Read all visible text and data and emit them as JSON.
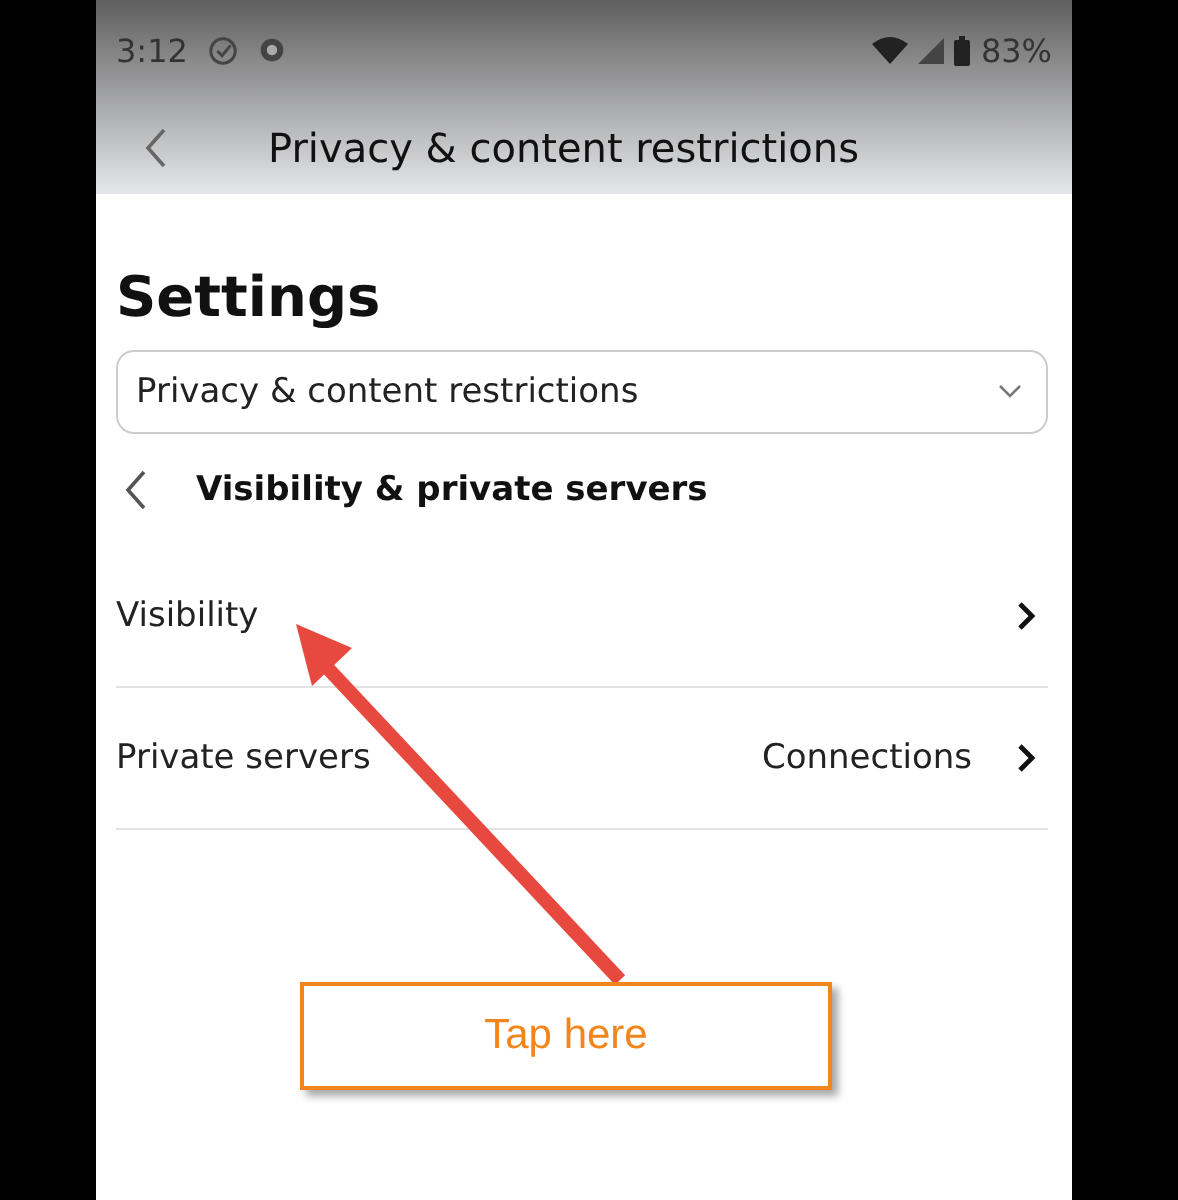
{
  "status_bar": {
    "time": "3:12",
    "battery": "83%"
  },
  "header": {
    "title": "Privacy & content restrictions"
  },
  "page_title": "Settings",
  "category_select": {
    "value": "Privacy & content restrictions"
  },
  "section": {
    "title": "Visibility & private servers"
  },
  "rows": [
    {
      "label": "Visibility"
    },
    {
      "label": "Private servers",
      "value": "Connections"
    }
  ],
  "annotation": {
    "callout": "Tap here"
  }
}
